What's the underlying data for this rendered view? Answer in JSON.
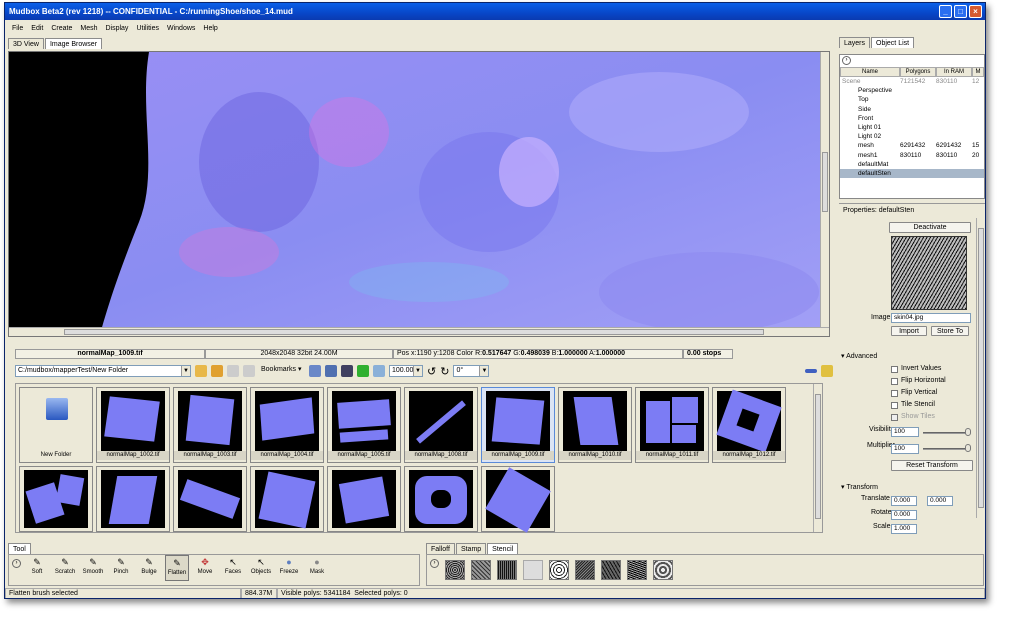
{
  "window": {
    "title": "Mudbox Beta2 (rev 1218) -- CONFIDENTIAL - C:/runningShoe/shoe_14.mud",
    "minimize": "_",
    "maximize": "□",
    "close": "×"
  },
  "menu": [
    "File",
    "Edit",
    "Create",
    "Mesh",
    "Display",
    "Utilities",
    "Windows",
    "Help"
  ],
  "view_tabs": [
    "3D View",
    "Image Browser"
  ],
  "image_info": {
    "name": "normalMap_1009.tif",
    "size": "2048x2048 32bit 24.00M",
    "pos": "Pos x:1190 y:1208 Color R:",
    "r": "0.517647",
    "g_label": " G:",
    "g": "0.498039",
    "b_label": " B:",
    "b": "1.000000",
    "a_label": " A:",
    "a": "1.000000",
    "stops": "0.00 stops"
  },
  "browser_toolbar": {
    "path": "C:/mudbox/mapperTest/New Folder",
    "bookmarks": "Bookmarks",
    "zoom": "100.00",
    "rotation": "0°"
  },
  "browser_items": [
    {
      "label": "New Folder"
    },
    {
      "label": "normalMap_1002.tif"
    },
    {
      "label": "normalMap_1003.tif"
    },
    {
      "label": "normalMap_1004.tif"
    },
    {
      "label": "normalMap_1005.tif"
    },
    {
      "label": "normalMap_1008.tif"
    },
    {
      "label": "normalMap_1009.tif"
    },
    {
      "label": "normalMap_1010.tif"
    },
    {
      "label": "normalMap_1011.tif"
    },
    {
      "label": "normalMap_1012.tif"
    }
  ],
  "right_tabs": [
    "Layers",
    "Object List"
  ],
  "object_list": {
    "columns": [
      "Name",
      "Polygons",
      "In RAM",
      "M"
    ],
    "rows": [
      {
        "name": "Scene",
        "polys": "7121542",
        "ram": "830110",
        "m": "12"
      },
      {
        "name": "Perspective",
        "polys": "",
        "ram": "",
        "m": ""
      },
      {
        "name": "Top",
        "polys": "",
        "ram": "",
        "m": ""
      },
      {
        "name": "Side",
        "polys": "",
        "ram": "",
        "m": ""
      },
      {
        "name": "Front",
        "polys": "",
        "ram": "",
        "m": ""
      },
      {
        "name": "Light 01",
        "polys": "",
        "ram": "",
        "m": ""
      },
      {
        "name": "Light 02",
        "polys": "",
        "ram": "",
        "m": ""
      },
      {
        "name": "mesh",
        "polys": "6291432",
        "ram": "6291432",
        "m": "15"
      },
      {
        "name": "mesh1",
        "polys": "830110",
        "ram": "830110",
        "m": "20"
      },
      {
        "name": "defaultMat",
        "polys": "",
        "ram": "",
        "m": ""
      },
      {
        "name": "defaultSten",
        "polys": "",
        "ram": "",
        "m": ""
      }
    ]
  },
  "properties": {
    "title": "Properties: defaultSten",
    "deactivate": "Deactivate",
    "image_label": "Image",
    "image_value": "skin04.jpg",
    "import": "Import",
    "store_to": "Store To",
    "advanced": "Advanced",
    "invert": "Invert Values",
    "flip_h": "Flip Horizontal",
    "flip_v": "Flip Vertical",
    "tile": "Tile Stencil",
    "show_tiles": "Show Tiles",
    "visibility_label": "Visibility",
    "visibility": "100",
    "multiplier_label": "Multiplier",
    "multiplier": "100",
    "reset": "Reset Transform",
    "transform": "Transform",
    "translate_label": "Translate",
    "translate_x": "0.000",
    "translate_y": "0.000",
    "rotate_label": "Rotate",
    "rotate": "0.000",
    "scale_label": "Scale",
    "scale": "1.000"
  },
  "tool_tab": "Tool",
  "tools": [
    "Soft",
    "Scratch",
    "Smooth",
    "Pinch",
    "Bulge",
    "Flatten",
    "Move",
    "Faces",
    "Objects",
    "Freeze",
    "Mask"
  ],
  "stamp_tabs": [
    "Falloff",
    "Stamp",
    "Stencil"
  ],
  "status": {
    "message": "Flatten brush selected",
    "memory": "884.37M",
    "visible": "Visible polys: 5341184",
    "selected": "Selected polys: 0"
  }
}
